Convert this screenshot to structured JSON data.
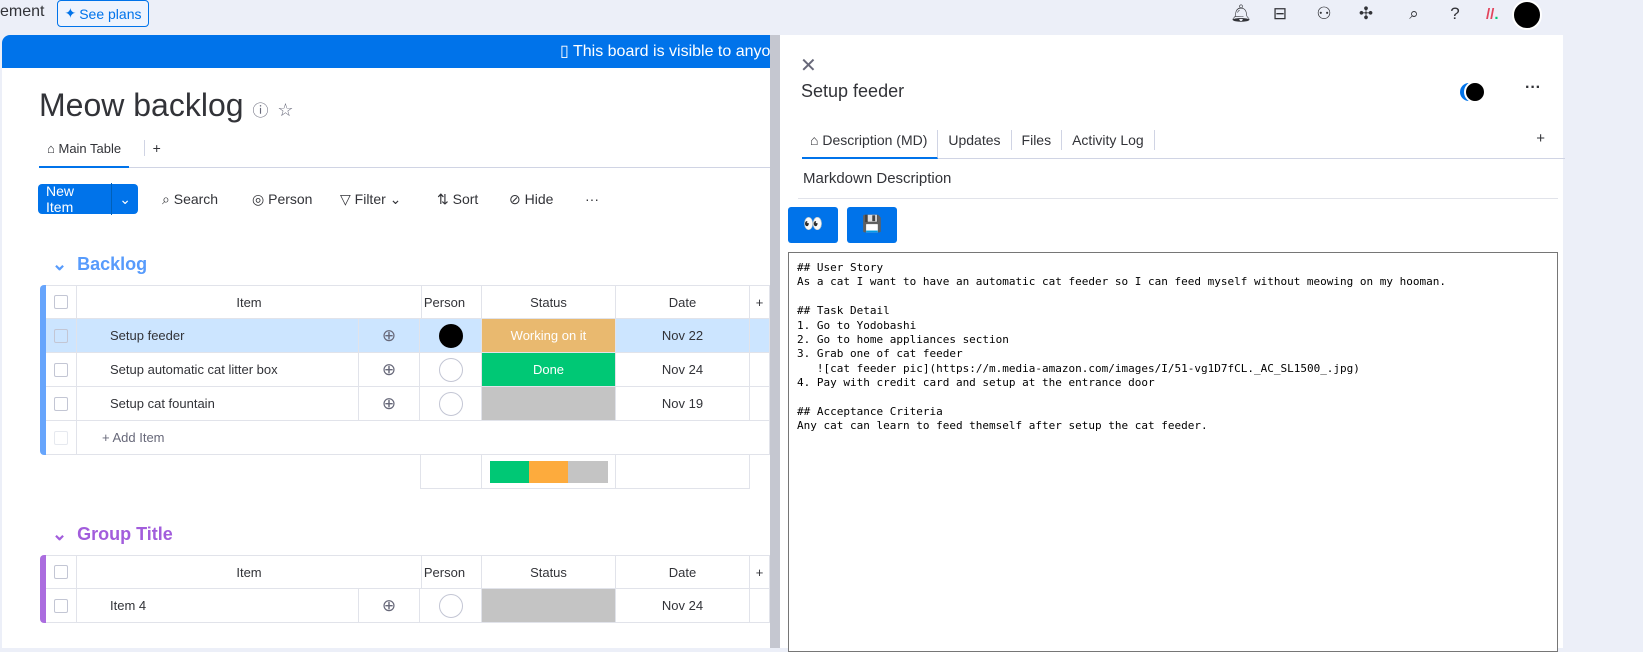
{
  "topbar": {
    "workspace_fragment": "ement",
    "see_plans": "See plans",
    "icons": [
      "bell-icon",
      "inbox-icon",
      "invite-icon",
      "apps-icon",
      "search-icon",
      "help-icon"
    ]
  },
  "board": {
    "banner": "This board is visible to anyo",
    "title": "Meow backlog",
    "tabs": [
      {
        "label": "Main Table"
      }
    ],
    "add_tab": "+",
    "toolbar": {
      "new_item": "New Item",
      "search": "Search",
      "person": "Person",
      "filter": "Filter",
      "sort": "Sort",
      "hide": "Hide",
      "more": "···"
    },
    "columns": {
      "item": "Item",
      "person": "Person",
      "status": "Status",
      "date": "Date",
      "add": "+"
    },
    "groups": [
      {
        "title": "Backlog",
        "color": "#579bfc",
        "rows": [
          {
            "name": "Setup feeder",
            "status": "Working on it",
            "status_color": "#fdab3d",
            "date": "Nov 22",
            "assigned": true,
            "selected": true
          },
          {
            "name": "Setup automatic cat litter box",
            "status": "Done",
            "status_color": "#00c875",
            "date": "Nov 24",
            "assigned": false
          },
          {
            "name": "Setup cat fountain",
            "status": "",
            "status_color": "#c4c4c4",
            "date": "Nov 19",
            "assigned": false
          }
        ],
        "add_item": "+ Add Item",
        "summary": [
          {
            "color": "#00c875",
            "fraction": 0.333
          },
          {
            "color": "#fdab3d",
            "fraction": 0.333
          },
          {
            "color": "#c4c4c4",
            "fraction": 0.334
          }
        ]
      },
      {
        "title": "Group Title",
        "color": "#a25ddc",
        "rows": [
          {
            "name": "Item 4",
            "status": "",
            "status_color": "#c4c4c4",
            "date": "Nov 24",
            "assigned": false
          }
        ]
      }
    ]
  },
  "panel": {
    "title": "Setup feeder",
    "more": "···",
    "tabs": [
      "Description (MD)",
      "Updates",
      "Files",
      "Activity Log"
    ],
    "add_tab": "+",
    "section": "Markdown Description",
    "buttons": {
      "preview": "👀",
      "save": "💾"
    },
    "markdown": "## User Story\nAs a cat I want to have an automatic cat feeder so I can feed myself without meowing on my hooman.\n\n## Task Detail\n1. Go to Yodobashi\n2. Go to home appliances section\n3. Grab one of cat feeder\n   ![cat feeder pic](https://m.media-amazon.com/images/I/51-vg1D7fCL._AC_SL1500_.jpg)\n4. Pay with credit card and setup at the entrance door\n\n## Acceptance Criteria\nAny cat can learn to feed themself after setup the cat feeder."
  }
}
